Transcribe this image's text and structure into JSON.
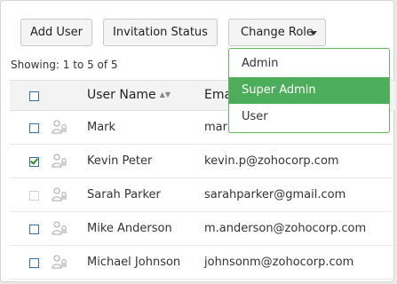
{
  "toolbar": {
    "add_user_label": "Add User",
    "invitation_status_label": "Invitation Status",
    "change_role_label": "Change Role"
  },
  "showing_text": "Showing: 1 to 5 of 5",
  "table": {
    "columns": [
      "User Name",
      "Email"
    ],
    "rows": [
      {
        "name": "Mark",
        "email": "mark",
        "checked": false,
        "disabled": false
      },
      {
        "name": "Kevin Peter",
        "email": "kevin.p@zohocorp.com",
        "checked": true,
        "disabled": false
      },
      {
        "name": "Sarah Parker",
        "email": "sarahparker@gmail.com",
        "checked": false,
        "disabled": true
      },
      {
        "name": "Mike Anderson",
        "email": "m.anderson@zohocorp.com",
        "checked": false,
        "disabled": false
      },
      {
        "name": "Michael Johnson",
        "email": "johnsonm@zohocorp.com",
        "checked": false,
        "disabled": false
      }
    ]
  },
  "role_dropdown": {
    "options": [
      "Admin",
      "Super Admin",
      "User"
    ],
    "highlighted": "Super Admin"
  },
  "colors": {
    "accent_green": "#4cae5b",
    "checkbox_blue": "#2f6dab"
  },
  "icons": {
    "user_row_icon": "user-lock-icon",
    "sort_icon": "sort-icon",
    "caret_icon": "chevron-down-icon"
  }
}
